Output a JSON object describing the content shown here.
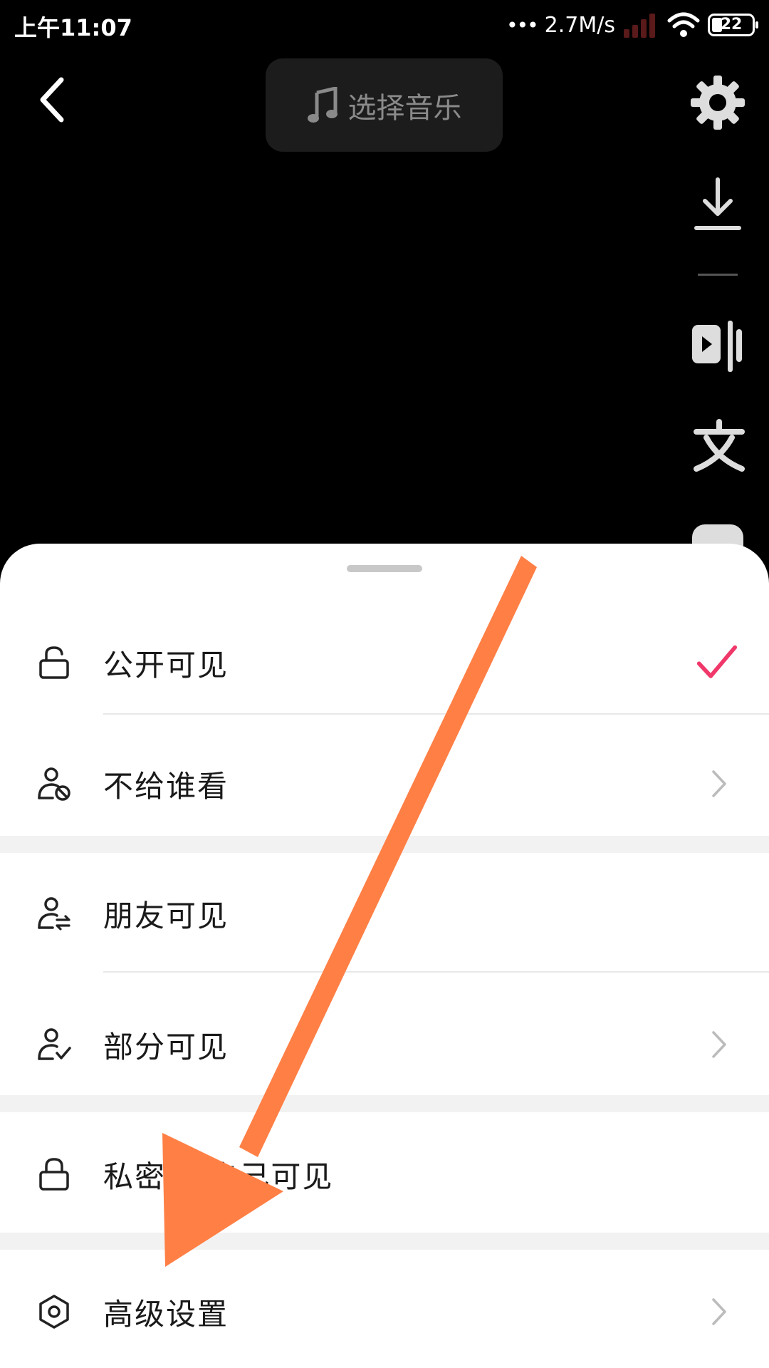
{
  "status": {
    "time": "上午11:07",
    "net_speed": "2.7M/s",
    "battery": "22"
  },
  "top": {
    "music_label": "选择音乐"
  },
  "privacy_options": [
    {
      "label": "公开可见",
      "icon": "lock-open-icon",
      "trail": "check-icon"
    },
    {
      "label": "不给谁看",
      "icon": "user-block-icon",
      "trail": "chevron-right-icon"
    },
    {
      "label": "朋友可见",
      "icon": "user-exchange-icon",
      "trail": ""
    },
    {
      "label": "部分可见",
      "icon": "user-check-icon",
      "trail": "chevron-right-icon"
    },
    {
      "label": "私密·仅自己可见",
      "icon": "lock-closed-icon",
      "trail": ""
    },
    {
      "label": "高级设置",
      "icon": "hexagon-settings-icon",
      "trail": "chevron-right-icon"
    }
  ],
  "colors": {
    "accent": "#F0386A",
    "annotation_arrow": "#FF7F45"
  }
}
